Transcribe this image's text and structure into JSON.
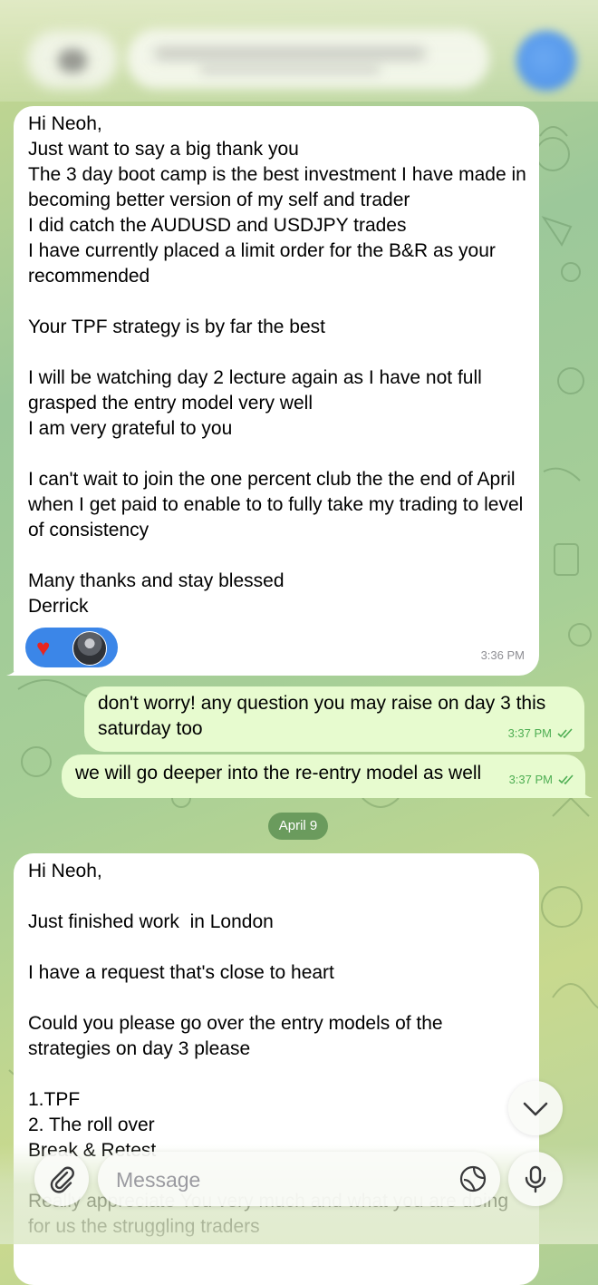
{
  "messages": [
    {
      "id": "msg1",
      "direction": "incoming",
      "text": "Hi Neoh,\nJust want to say a big thank you\nThe 3 day boot camp is the best investment I have made in becoming better version of my self and trader\nI did catch the AUDUSD and USDJPY trades\nI have currently placed a limit order for the B&R as your recommended\n\nYour TPF strategy is by far the best\n\nI will be watching day 2 lecture again as I have not full grasped the entry model very well\nI am very grateful to you\n\nI can't wait to join the one percent club the the end of April when I get paid to enable to to fully take my trading to level of consistency\n\nMany thanks and stay blessed\nDerrick",
      "time": "3:36 PM",
      "reactions": [
        "heart-icon",
        "reactor-avatar"
      ]
    },
    {
      "id": "msg2",
      "direction": "outgoing",
      "text": "don't worry! any question you may raise on day 3 this saturday too",
      "time": "3:37 PM",
      "status": "read"
    },
    {
      "id": "msg3",
      "direction": "outgoing",
      "text": "we will go deeper into the re-entry model as well",
      "time": "3:37 PM",
      "status": "read"
    },
    {
      "id": "msg4",
      "direction": "incoming",
      "text": "Hi Neoh,\n\nJust finished work  in London\n\nI have a request that's close to heart\n\nCould you please go over the entry models of the strategies on day 3 please\n\n1.TPF\n2. The roll over\nBreak & Retest\n\nReally appreciate You very much and what you are doing for us the struggling traders"
    }
  ],
  "date_separator": "April 9",
  "composer": {
    "placeholder": "Message"
  },
  "colors": {
    "incoming_bubble": "#ffffff",
    "outgoing_bubble": "#e7fbcf",
    "outgoing_time": "#4eae53",
    "reaction_pill": "#3b86e8",
    "date_pill": "#568c4e"
  },
  "icons": [
    "attach-icon",
    "sticker-icon",
    "mic-icon",
    "chevron-down-icon",
    "read-checkmark-icon",
    "heart-icon"
  ]
}
